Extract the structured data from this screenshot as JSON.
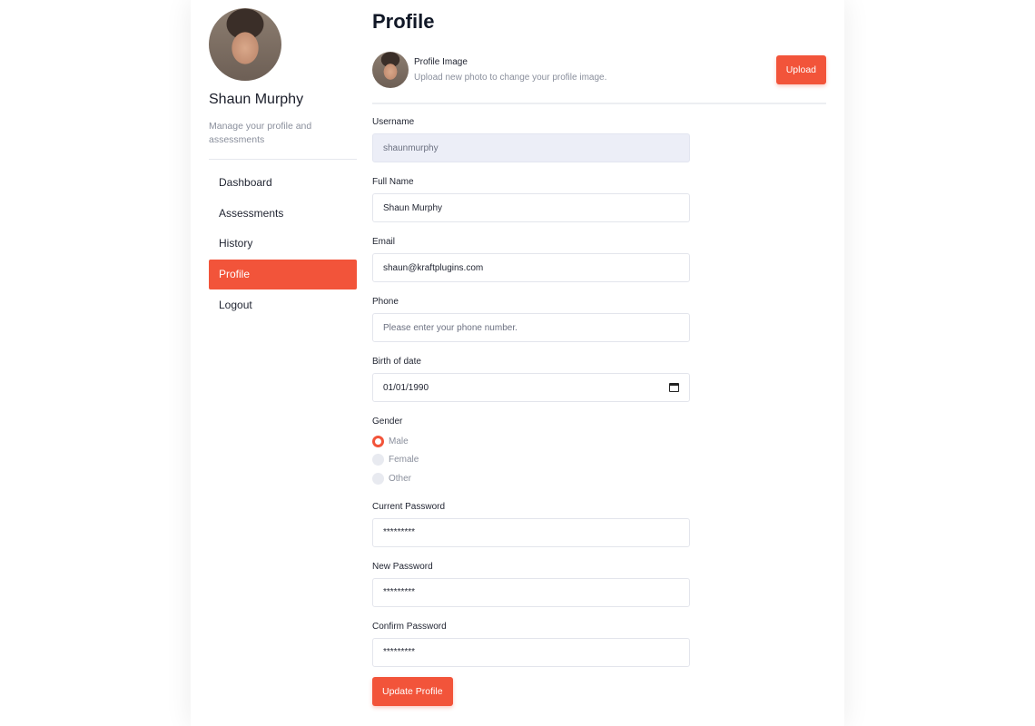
{
  "user": {
    "name": "Shaun Murphy",
    "subtitle": "Manage your profile and assessments"
  },
  "nav": [
    {
      "label": "Dashboard"
    },
    {
      "label": "Assessments"
    },
    {
      "label": "History"
    },
    {
      "label": "Profile",
      "active": true
    },
    {
      "label": "Logout"
    }
  ],
  "page": {
    "title": "Profile"
  },
  "profile_image": {
    "title": "Profile Image",
    "description": "Upload new photo to change your profile image.",
    "upload_label": "Upload"
  },
  "form": {
    "username": {
      "label": "Username",
      "value": "shaunmurphy"
    },
    "full_name": {
      "label": "Full Name",
      "value": "Shaun Murphy"
    },
    "email": {
      "label": "Email",
      "value": "shaun@kraftplugins.com"
    },
    "phone": {
      "label": "Phone",
      "placeholder": "Please enter your phone number."
    },
    "birth": {
      "label": "Birth of date",
      "value": "01/01/1990"
    },
    "gender": {
      "label": "Gender",
      "options": [
        "Male",
        "Female",
        "Other"
      ],
      "selected": "Male"
    },
    "current_password": {
      "label": "Current Password",
      "value": "*********"
    },
    "new_password": {
      "label": "New Password",
      "value": "*********"
    },
    "confirm_password": {
      "label": "Confirm Password",
      "value": "*********"
    },
    "submit_label": "Update Profile"
  },
  "colors": {
    "accent": "#f2543a"
  }
}
